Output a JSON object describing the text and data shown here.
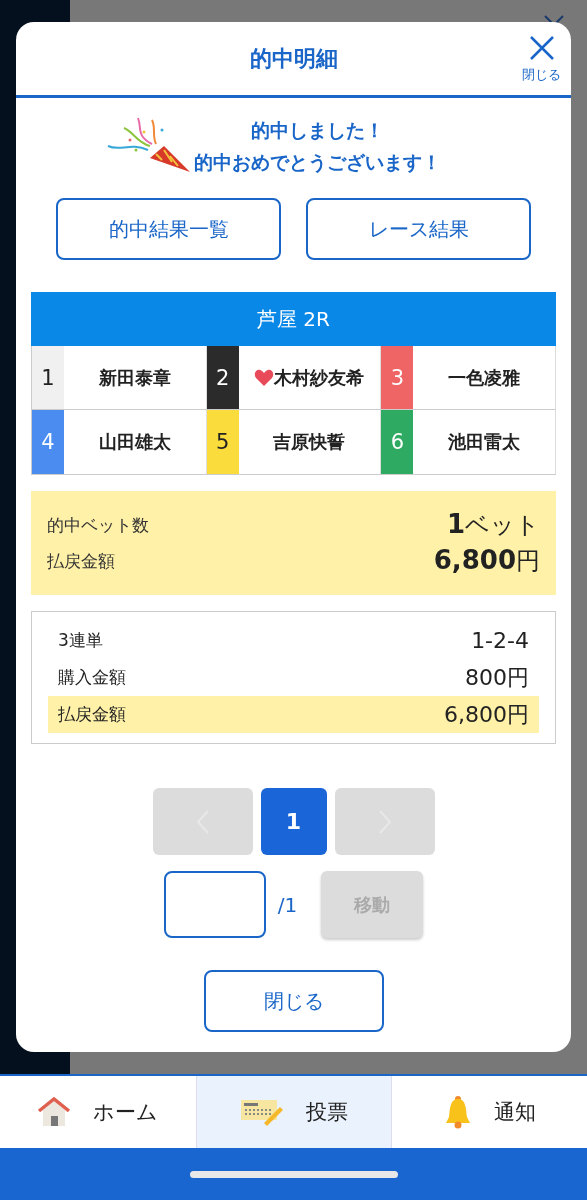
{
  "modal": {
    "title": "的中明細",
    "close_label": "閉じる"
  },
  "congrats": {
    "lines": [
      "的中しました！",
      "的中おめでとうございます！"
    ]
  },
  "links": [
    "的中結果一覧",
    "レース結果"
  ],
  "race": {
    "title": "芦屋 2R",
    "racers": [
      {
        "number": "1",
        "name": "新田泰章",
        "color": "#f0f0f0",
        "heart": false
      },
      {
        "number": "2",
        "name": "木村紗友希",
        "color": "#2b2b2b",
        "heart": true
      },
      {
        "number": "3",
        "name": "一色凌雅",
        "color": "#ef6464",
        "heart": false
      },
      {
        "number": "4",
        "name": "山田雄太",
        "color": "#4a8cf0",
        "heart": false
      },
      {
        "number": "5",
        "name": "吉原快誓",
        "color": "#fadc3c",
        "heart": false
      },
      {
        "number": "6",
        "name": "池田雷太",
        "color": "#2eaa62",
        "heart": false
      }
    ]
  },
  "summary": [
    {
      "label": "的中ベット数",
      "value": "**1**ベット"
    },
    {
      "label": "払戻金額",
      "value": "**6,800**円"
    }
  ],
  "bet": [
    {
      "label": "3連単",
      "value": "1-2-4",
      "highlight": false
    },
    {
      "label": "購入金額",
      "value": "800円",
      "highlight": false
    },
    {
      "label": "払戻金額",
      "value": "6,800円",
      "highlight": true
    }
  ],
  "pagination": {
    "prev_disabled": true,
    "next_disabled": true,
    "pages": [
      {
        "label": "1",
        "selected": true
      }
    ]
  },
  "jump": {
    "total": "/1",
    "button": "移動",
    "disabled": true
  },
  "close_button": "閉じる",
  "nav": [
    {
      "label": "ホーム",
      "selected": false
    },
    {
      "label": "投票",
      "selected": true
    },
    {
      "label": "通知",
      "selected": false
    }
  ]
}
